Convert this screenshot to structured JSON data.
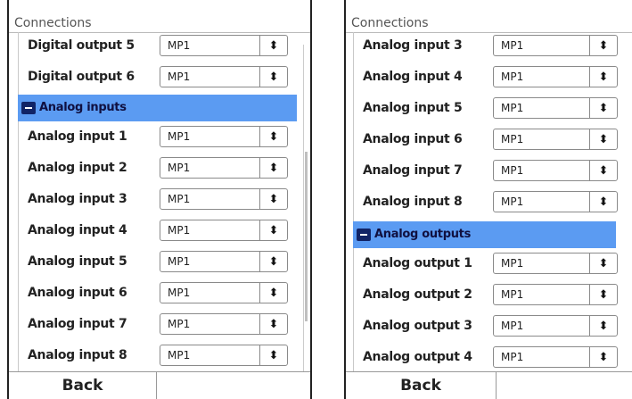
{
  "left": {
    "title": "Connections",
    "rows_top": [
      {
        "label": "Digital output 5",
        "value": "MP1"
      },
      {
        "label": "Digital output 6",
        "value": "MP1"
      }
    ],
    "group": {
      "label": "Analog inputs",
      "icon": "collapse-minus-icon"
    },
    "rows_bottom": [
      {
        "label": "Analog input 1",
        "value": "MP1"
      },
      {
        "label": "Analog input 2",
        "value": "MP1"
      },
      {
        "label": "Analog input 3",
        "value": "MP1"
      },
      {
        "label": "Analog input 4",
        "value": "MP1"
      },
      {
        "label": "Analog input 5",
        "value": "MP1"
      },
      {
        "label": "Analog input 6",
        "value": "MP1"
      },
      {
        "label": "Analog input 7",
        "value": "MP1"
      },
      {
        "label": "Analog input 8",
        "value": "MP1"
      }
    ],
    "back_label": "Back"
  },
  "right": {
    "title": "Connections",
    "rows_top": [
      {
        "label": "Analog input 3",
        "value": "MP1"
      },
      {
        "label": "Analog input 4",
        "value": "MP1"
      },
      {
        "label": "Analog input 5",
        "value": "MP1"
      },
      {
        "label": "Analog input 6",
        "value": "MP1"
      },
      {
        "label": "Analog input 7",
        "value": "MP1"
      },
      {
        "label": "Analog input 8",
        "value": "MP1"
      }
    ],
    "group": {
      "label": "Analog outputs",
      "icon": "collapse-minus-icon"
    },
    "rows_bottom": [
      {
        "label": "Analog output 1",
        "value": "MP1"
      },
      {
        "label": "Analog output 2",
        "value": "MP1"
      },
      {
        "label": "Analog output 3",
        "value": "MP1"
      },
      {
        "label": "Analog output 4",
        "value": "MP1"
      }
    ],
    "back_label": "Back"
  },
  "colors": {
    "group_header": "#5b9bf2",
    "collapse_icon": "#112466"
  },
  "icons": {
    "select_arrow": "up-down-arrows-icon"
  }
}
